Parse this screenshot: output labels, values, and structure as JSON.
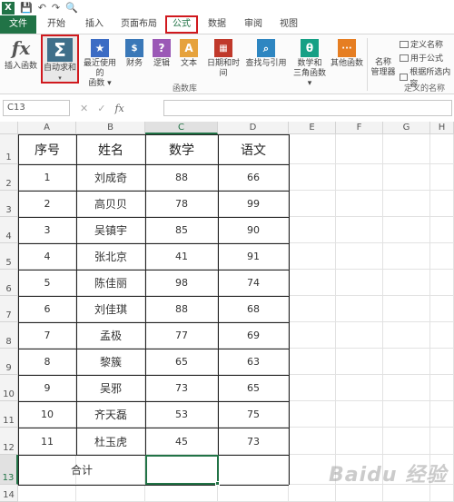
{
  "quick_access": {
    "app_icon": "X",
    "save_icon": "💾",
    "undo_icon": "↶",
    "redo_icon": "↷",
    "preview_icon": "🔍"
  },
  "tabs": [
    "文件",
    "开始",
    "插入",
    "页面布局",
    "公式",
    "数据",
    "审阅",
    "视图"
  ],
  "ribbon": {
    "insert_function": "插入函数",
    "autosum": "自动求和",
    "recently_used": "最近使用的",
    "recently_used_2": "函数 ▾",
    "financial": "财务",
    "logical": "逻辑",
    "text": "文本",
    "datetime": "日期和时间",
    "lookup": "查找与引用",
    "math": "数学和",
    "math_2": "三角函数 ▾",
    "other": "其他函数",
    "name_manager": "名称",
    "name_manager_2": "管理器",
    "define_name": "定义名称",
    "use_in_formula": "用于公式",
    "create_from_selection": "根据所选内容",
    "group_library": "函数库",
    "group_names": "定义的名称"
  },
  "formula_bar": {
    "name_box": "C13",
    "cancel": "✕",
    "enter": "✓",
    "fx": "fx",
    "content": ""
  },
  "columns": [
    "A",
    "B",
    "C",
    "D",
    "E",
    "F",
    "G",
    "H"
  ],
  "rows": [
    "1",
    "2",
    "3",
    "4",
    "5",
    "6",
    "7",
    "8",
    "9",
    "10",
    "11",
    "12",
    "13",
    "14"
  ],
  "sheet": {
    "headers": [
      "序号",
      "姓名",
      "数学",
      "语文"
    ],
    "data": [
      [
        "1",
        "刘成奇",
        "88",
        "66"
      ],
      [
        "2",
        "高贝贝",
        "78",
        "99"
      ],
      [
        "3",
        "吴镇宇",
        "85",
        "90"
      ],
      [
        "4",
        "张北京",
        "41",
        "91"
      ],
      [
        "5",
        "陈佳丽",
        "98",
        "74"
      ],
      [
        "6",
        "刘佳琪",
        "88",
        "68"
      ],
      [
        "7",
        "孟极",
        "77",
        "69"
      ],
      [
        "8",
        "黎簇",
        "65",
        "63"
      ],
      [
        "9",
        "吴邪",
        "73",
        "65"
      ],
      [
        "10",
        "齐天磊",
        "53",
        "75"
      ],
      [
        "11",
        "杜玉虎",
        "45",
        "73"
      ]
    ],
    "total_label": "合计"
  },
  "watermark": "Baidu 经验",
  "colors": {
    "excel_green": "#217346",
    "highlight_red": "#d0191e"
  }
}
